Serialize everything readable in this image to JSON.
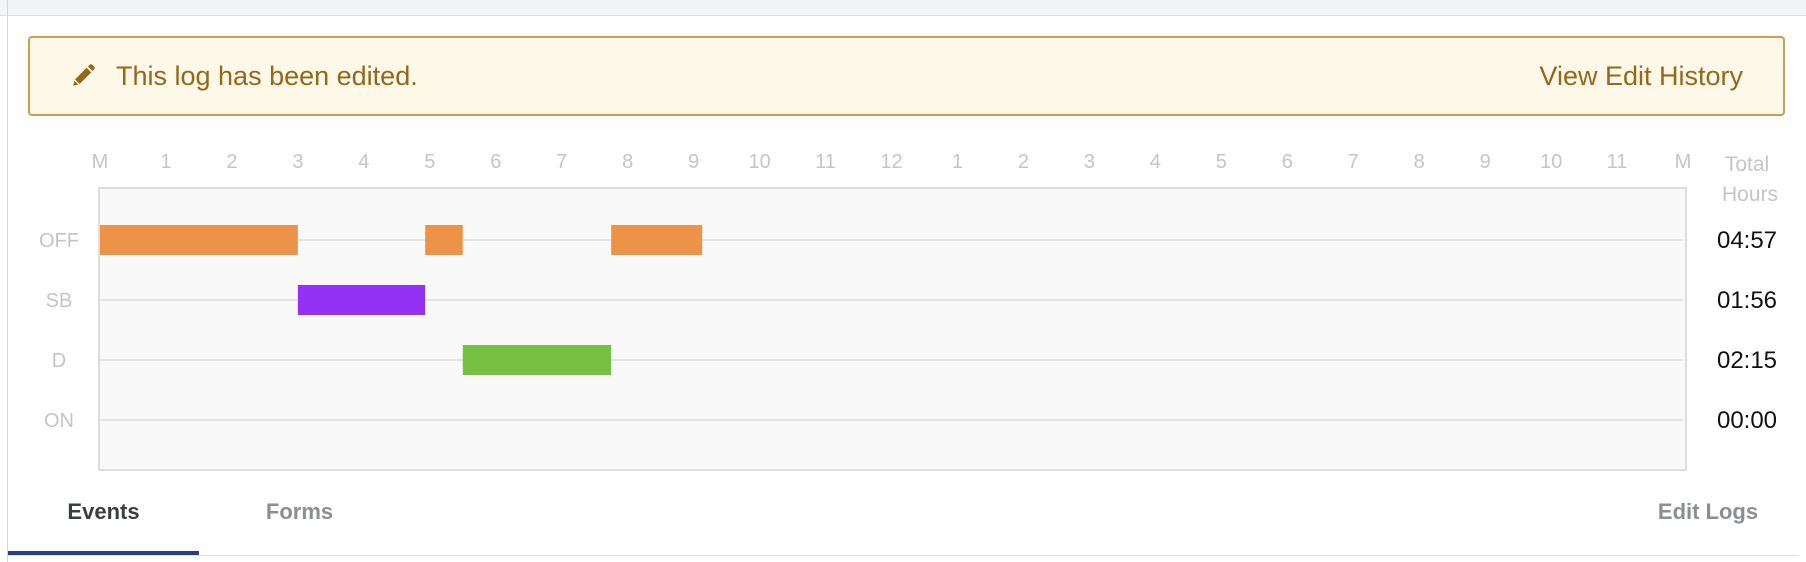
{
  "banner": {
    "icon": "pencil-icon",
    "message": "This log has been edited.",
    "link_label": "View Edit History",
    "color": "#94681a"
  },
  "chart_data": {
    "type": "gantt",
    "x_labels": [
      "M",
      "1",
      "2",
      "3",
      "4",
      "5",
      "6",
      "7",
      "8",
      "9",
      "10",
      "11",
      "12",
      "1",
      "2",
      "3",
      "4",
      "5",
      "6",
      "7",
      "8",
      "9",
      "10",
      "11",
      "M"
    ],
    "x_range_hours": [
      0,
      24
    ],
    "status_labels": [
      "OFF",
      "SB",
      "D",
      "ON"
    ],
    "total_header": [
      "Total",
      "Hours"
    ],
    "totals": [
      "04:57",
      "01:56",
      "02:15",
      "00:00"
    ],
    "segments": [
      {
        "status": "OFF",
        "start": 0.0,
        "end": 3.0,
        "color": "#ed9347"
      },
      {
        "status": "SB",
        "start": 3.0,
        "end": 4.93,
        "color": "#9431f5"
      },
      {
        "status": "OFF",
        "start": 4.93,
        "end": 5.5,
        "color": "#ed9347"
      },
      {
        "status": "D",
        "start": 5.5,
        "end": 7.75,
        "color": "#76c043"
      },
      {
        "status": "OFF",
        "start": 7.75,
        "end": 9.13,
        "color": "#ed9347"
      }
    ],
    "grid": true
  },
  "tabs": {
    "events": "Events",
    "forms": "Forms",
    "edit_logs": "Edit Logs"
  }
}
